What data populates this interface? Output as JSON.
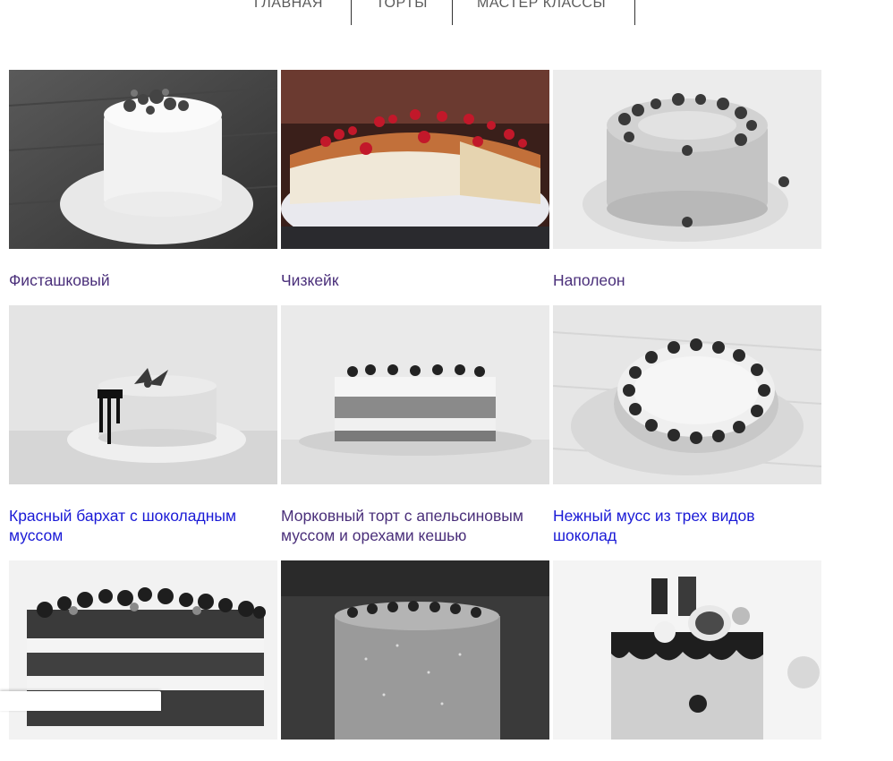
{
  "nav": {
    "items": [
      {
        "label": "ГЛАВНАЯ"
      },
      {
        "label": "ТОРТЫ"
      },
      {
        "label": "МАСТЕР КЛАССЫ"
      }
    ]
  },
  "products": [
    {
      "title": "Фисташковый",
      "visited": true
    },
    {
      "title": "Чизкейк",
      "visited": true
    },
    {
      "title": "Наполеон",
      "visited": true
    },
    {
      "title": "Красный бархат с шоколадным муссом",
      "visited": false
    },
    {
      "title": "Морковный торт с апельсиновым муссом и орехами кешью",
      "visited": true
    },
    {
      "title": "Нежный мусс из трех видов шоколад",
      "visited": false
    },
    {
      "title": "",
      "visited": false
    },
    {
      "title": "",
      "visited": false
    },
    {
      "title": "",
      "visited": false
    }
  ],
  "colors": {
    "link_visited": "#4a2f7a",
    "link_unvisited": "#1a1ad6",
    "nav_text": "#5a5a5a"
  }
}
